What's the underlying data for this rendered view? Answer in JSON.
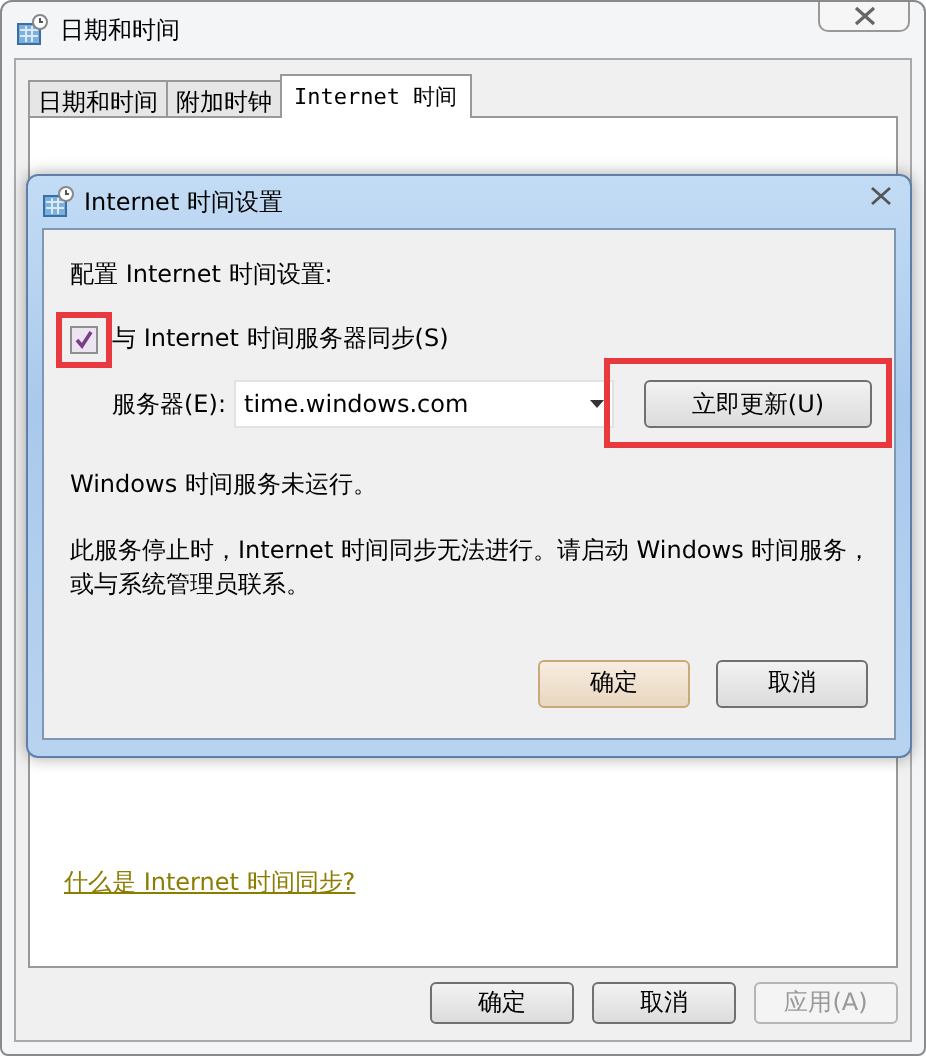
{
  "window": {
    "title": "日期和时间"
  },
  "tabs": [
    {
      "label": "日期和时间",
      "selected": false
    },
    {
      "label": "附加时钟",
      "selected": false
    },
    {
      "label": "Internet 时间",
      "selected": true
    }
  ],
  "help_link": "什么是 Internet 时间同步?",
  "buttons": [
    {
      "label": "确定",
      "disabled": false
    },
    {
      "label": "取消",
      "disabled": false
    },
    {
      "label": "应用(A)",
      "disabled": true
    }
  ],
  "dialog": {
    "title": "Internet 时间设置",
    "heading": "配置 Internet 时间设置:",
    "sync": {
      "label": "与 Internet 时间服务器同步(S)",
      "checked": true,
      "highlighted": true
    },
    "server": {
      "label": "服务器(E):",
      "value": "time.windows.com"
    },
    "update_button": {
      "label": "立即更新(U)",
      "highlighted": true
    },
    "status": "Windows 时间服务未运行。",
    "message": "此服务停止时，Internet 时间同步无法进行。请启动 Windows 时间服务，或与系统管理员联系。",
    "buttons": [
      {
        "label": "确定",
        "default": true
      },
      {
        "label": "取消",
        "default": false
      }
    ]
  }
}
